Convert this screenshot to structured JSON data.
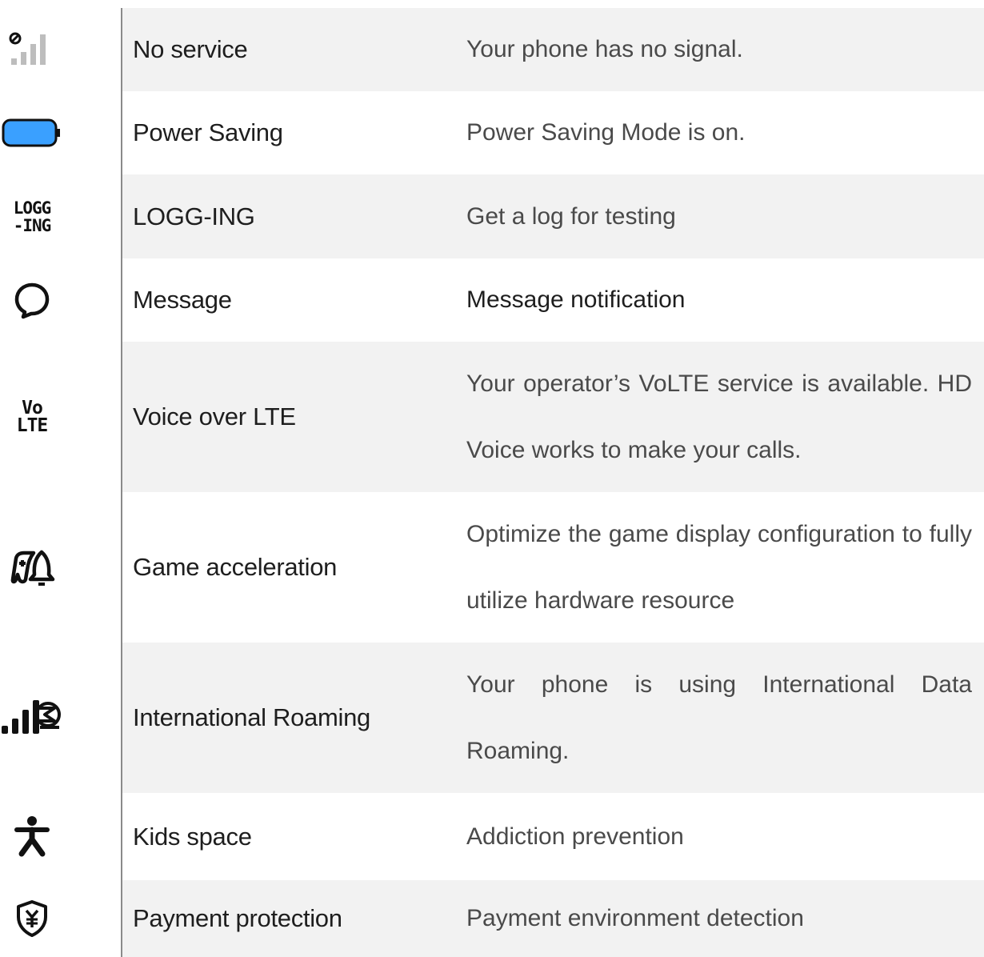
{
  "rows": [
    {
      "icon": "no-signal-icon",
      "name": "No service",
      "desc": "Your phone has no signal."
    },
    {
      "icon": "battery-saver-icon",
      "name": "Power Saving",
      "desc": "Power Saving Mode is on."
    },
    {
      "icon": "logging-icon",
      "icon_text": [
        "LOGG",
        "-ING"
      ],
      "name": "LOGG-ING",
      "desc": "Get a log for testing"
    },
    {
      "icon": "message-bubble-icon",
      "name": "Message",
      "desc": "Message notification"
    },
    {
      "icon": "volte-icon",
      "icon_text": [
        "Vo",
        "LTE"
      ],
      "name": "Voice over LTE",
      "desc": "Your operator’s VoLTE service is available. HD Voice works to make your calls."
    },
    {
      "icon": "game-rocket-icon",
      "name": "Game acceleration",
      "desc": "Optimize the game display configuration to fully utilize hardware resource"
    },
    {
      "icon": "roaming-signal-icon",
      "name": "International Roaming",
      "desc": "Your phone is using International Data Roaming."
    },
    {
      "icon": "kid-icon",
      "name": "Kids space",
      "desc": "Addiction prevention"
    },
    {
      "icon": "shield-yen-icon",
      "name": "Payment protection",
      "desc": "Payment environment detection"
    }
  ],
  "colors": {
    "band": "#f2f2f2",
    "battery_fill": "#3aa0ff",
    "divider": "#8a8a8a"
  }
}
